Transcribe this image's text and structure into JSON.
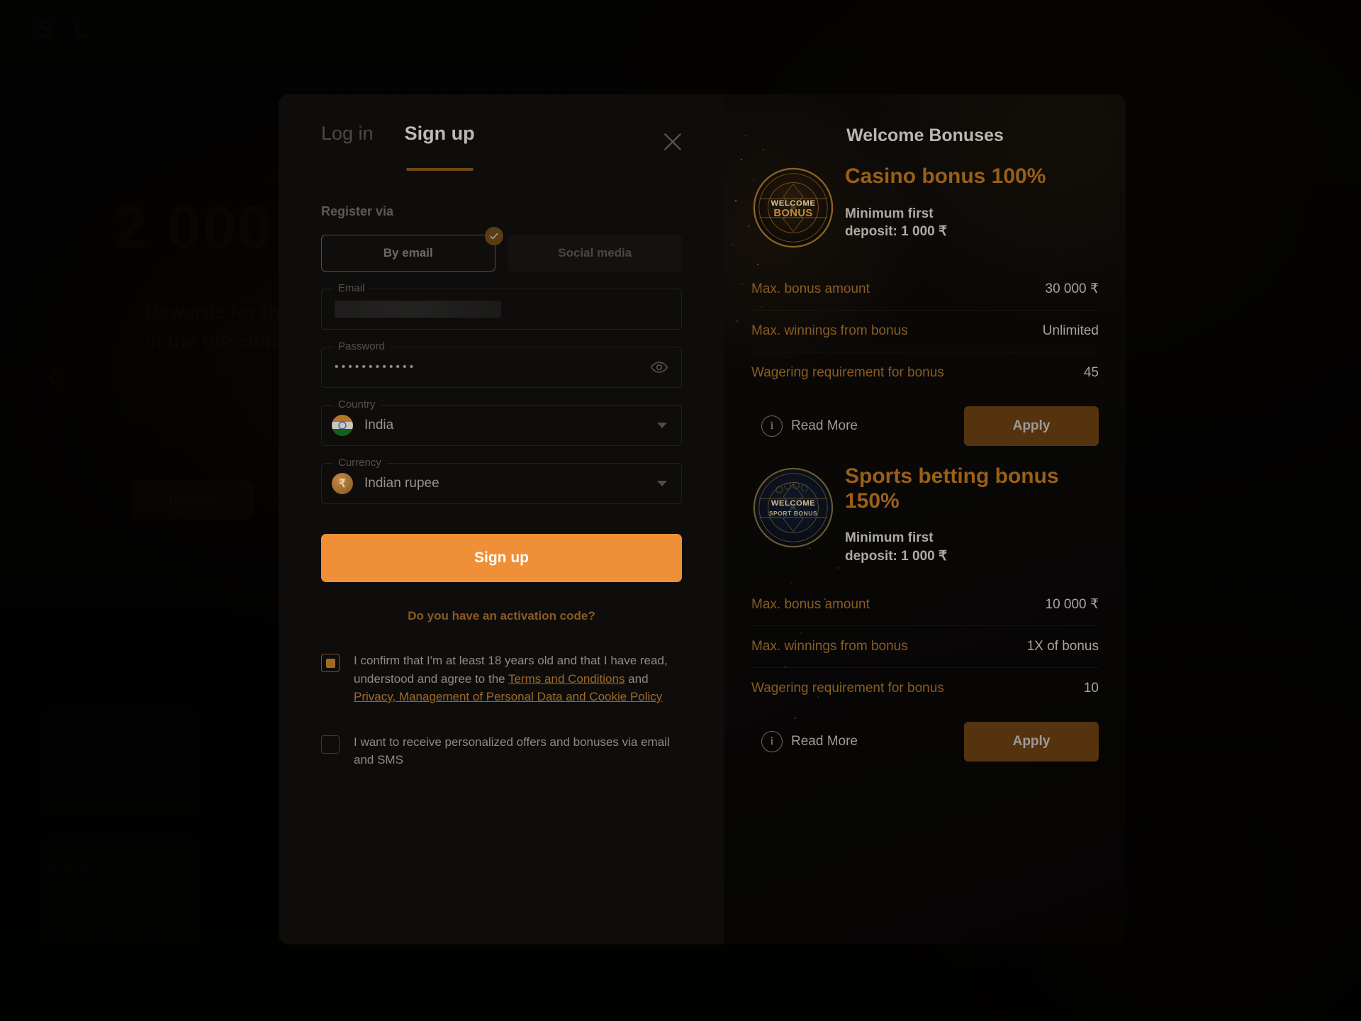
{
  "background": {
    "logo_text": "S L",
    "hero_amount": "2 000",
    "hero_sub": "Rewards for the\nin the VIP club",
    "hero_button": "Register",
    "tile_label": "Register"
  },
  "modal": {
    "tabs": [
      {
        "label": "Log in",
        "active": false
      },
      {
        "label": "Sign up",
        "active": true
      }
    ],
    "close_icon": "close-icon",
    "register_via_label": "Register via",
    "methods": [
      {
        "label": "By email",
        "selected": true
      },
      {
        "label": "Social media",
        "selected": false
      }
    ],
    "fields": {
      "email": {
        "legend": "Email",
        "value": "",
        "placeholder": "Email"
      },
      "password": {
        "legend": "Password",
        "value": "••••••••••••",
        "placeholder": "Password"
      },
      "country": {
        "legend": "Country",
        "value": "India",
        "flag_icon": "flag-india-icon"
      },
      "currency": {
        "legend": "Currency",
        "value": "Indian rupee",
        "coin_icon": "rupee-coin-icon",
        "coin_symbol": "₹"
      }
    },
    "signup_button": "Sign up",
    "activation_link": "Do you have an activation code?",
    "consents": [
      {
        "checked": true,
        "text_before": "I confirm that I'm at least 18 years old and that I have read, understood and agree to the ",
        "link1": "Terms and Conditions",
        "text_middle": " and ",
        "link2": "Privacy, Management of Personal Data and Cookie Policy",
        "text_after": ""
      },
      {
        "checked": false,
        "text_before": "I want to receive personalized offers and bonuses via email and SMS",
        "link1": "",
        "text_middle": "",
        "link2": "",
        "text_after": ""
      }
    ]
  },
  "bonuses_panel": {
    "title": "Welcome Bonuses",
    "items": [
      {
        "badge_icon": "welcome-bonus-badge-icon",
        "badge_line1": "WELCOME",
        "badge_line2": "BONUS",
        "title": "Casino bonus 100%",
        "min_deposit": "Minimum first\ndeposit: 1 000 ₹",
        "rows": [
          {
            "key": "Max. bonus amount",
            "value": "30 000 ₹"
          },
          {
            "key": "Max. winnings from bonus",
            "value": "Unlimited"
          },
          {
            "key": "Wagering requirement for bonus",
            "value": "45"
          }
        ],
        "read_more": "Read More",
        "apply": "Apply"
      },
      {
        "badge_icon": "welcome-sport-bonus-badge-icon",
        "badge_line1": "WELCOME",
        "badge_line2": "SPORT BONUS",
        "title": "Sports betting bonus 150%",
        "min_deposit": "Minimum first\ndeposit: 1 000 ₹",
        "rows": [
          {
            "key": "Max. bonus amount",
            "value": "10 000 ₹"
          },
          {
            "key": "Max. winnings from bonus",
            "value": "1X of bonus"
          },
          {
            "key": "Wagering requirement for bonus",
            "value": "10"
          }
        ],
        "read_more": "Read More",
        "apply": "Apply"
      }
    ]
  },
  "colors": {
    "accent_orange": "#ef9038",
    "accent_brown": "#9a5f18",
    "modal_bg": "#0e0d0c",
    "apply_bg": "#55330f"
  }
}
